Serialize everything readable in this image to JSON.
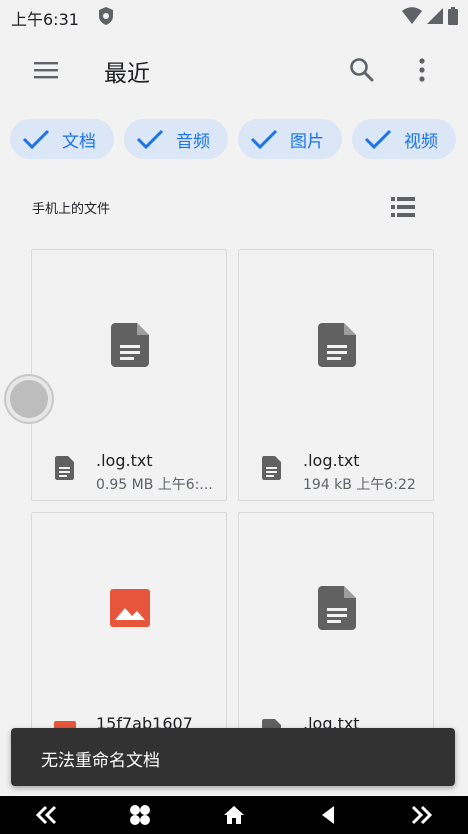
{
  "status_bar": {
    "time": "上午6:31"
  },
  "app_bar": {
    "title": "最近"
  },
  "filters": [
    {
      "label": "文档"
    },
    {
      "label": "音频"
    },
    {
      "label": "图片"
    },
    {
      "label": "视频"
    }
  ],
  "section": {
    "label": "手机上的文件"
  },
  "files": [
    {
      "name": ".log.txt",
      "details": "0.95 MB  上午6:...",
      "type": "document"
    },
    {
      "name": ".log.txt",
      "details": "194 kB  上午6:22",
      "type": "document"
    },
    {
      "name": "15f7ab1607",
      "details": "",
      "type": "image"
    },
    {
      "name": ".log.txt",
      "details": "",
      "type": "document"
    }
  ],
  "snackbar": {
    "message": "无法重命名文档"
  },
  "colors": {
    "accent": "#1a73e8",
    "chip_bg": "#dbe6f7",
    "image_icon": "#e8553d",
    "doc_icon": "#616161"
  },
  "icons": {
    "status": [
      "shield-icon",
      "wifi-icon",
      "signal-icon",
      "battery-icon"
    ],
    "app_bar": [
      "menu-icon",
      "search-icon",
      "more-vert-icon"
    ],
    "nav": [
      "rewind-icon",
      "apps-icon",
      "home-icon",
      "back-icon",
      "fast-forward-icon"
    ]
  }
}
